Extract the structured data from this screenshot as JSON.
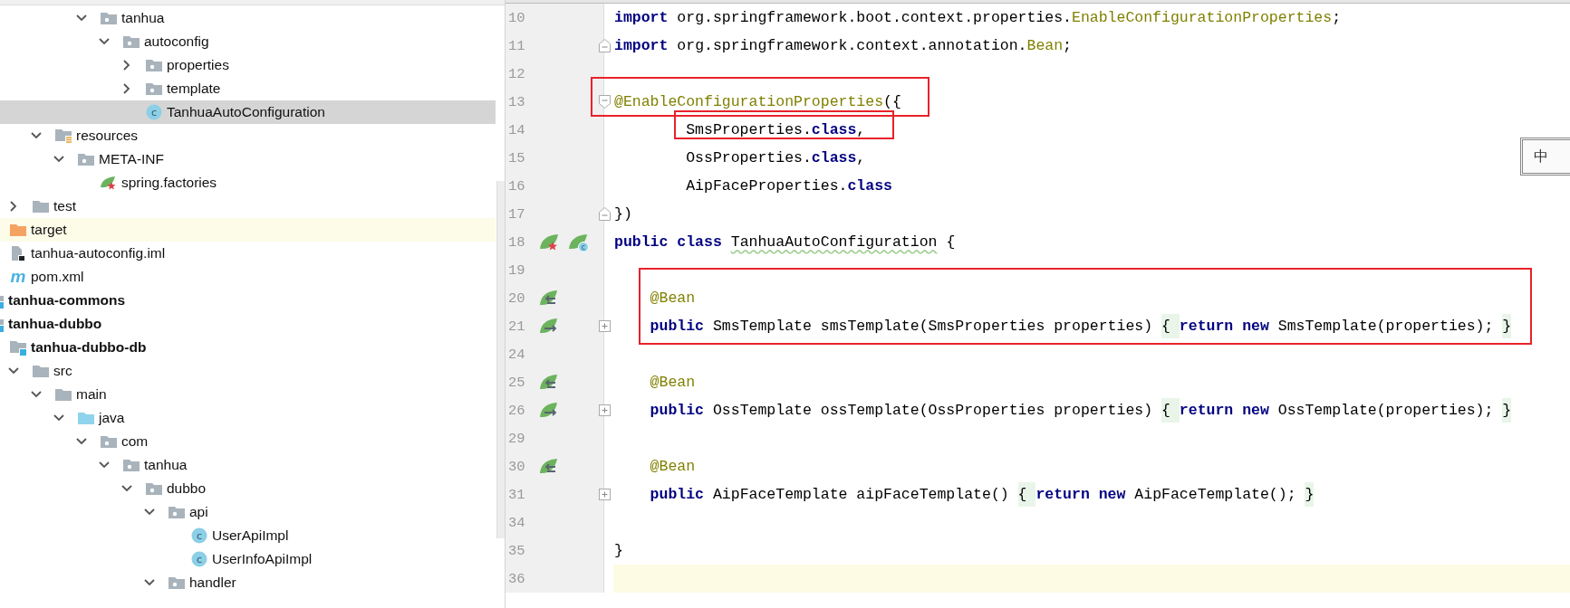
{
  "project_tree": {
    "items": [
      {
        "children": [
          {
            "children": [
              {
                "children": [
                  {
                    "children": [
                      {
                        "children": [
                          {
                            "label": "tanhua",
                            "kind": "package",
                            "expanded": true,
                            "selected": false,
                            "highlighted": false,
                            "children": [
                              {
                                "label": "autoconfig",
                                "kind": "package",
                                "expanded": true,
                                "selected": false,
                                "highlighted": false,
                                "children": [
                                  {
                                    "label": "properties",
                                    "kind": "package",
                                    "expanded": false,
                                    "selected": false,
                                    "highlighted": false
                                  },
                                  {
                                    "label": "template",
                                    "kind": "package",
                                    "expanded": false,
                                    "selected": false,
                                    "highlighted": false
                                  },
                                  {
                                    "label": "TanhuaAutoConfiguration",
                                    "kind": "class",
                                    "icon_text": "c",
                                    "selected": true,
                                    "highlighted": false
                                  }
                                ]
                              }
                            ]
                          }
                        ]
                      }
                    ]
                  },
                  {
                    "label": "resources",
                    "kind": "resources",
                    "expanded": true,
                    "selected": false,
                    "highlighted": false,
                    "children": [
                      {
                        "label": "META-INF",
                        "kind": "package",
                        "expanded": true,
                        "selected": false,
                        "highlighted": false,
                        "children": [
                          {
                            "label": "spring.factories",
                            "kind": "spring",
                            "selected": false,
                            "highlighted": false
                          }
                        ]
                      }
                    ]
                  }
                ]
              },
              {
                "label": "test",
                "kind": "folder",
                "expanded": false,
                "selected": false,
                "highlighted": false
              }
            ]
          },
          {
            "label": "target",
            "kind": "excluded",
            "selected": false,
            "highlighted": true
          },
          {
            "label": "tanhua-autoconfig.iml",
            "kind": "iml",
            "selected": false,
            "highlighted": false
          },
          {
            "label": "pom.xml",
            "kind": "maven",
            "icon_text": "m",
            "selected": false,
            "highlighted": false
          }
        ]
      },
      {
        "label": "tanhua-commons",
        "kind": "module",
        "selected": false,
        "highlighted": false
      },
      {
        "label": "tanhua-dubbo",
        "kind": "module",
        "selected": false,
        "highlighted": false,
        "children": [
          {
            "label": "tanhua-dubbo-db",
            "kind": "module",
            "selected": false,
            "highlighted": false,
            "children": [
              {
                "label": "src",
                "kind": "folder",
                "expanded": true,
                "selected": false,
                "highlighted": false,
                "children": [
                  {
                    "label": "main",
                    "kind": "folder",
                    "expanded": true,
                    "selected": false,
                    "highlighted": false,
                    "children": [
                      {
                        "label": "java",
                        "kind": "source",
                        "expanded": true,
                        "selected": false,
                        "highlighted": false,
                        "children": [
                          {
                            "label": "com",
                            "kind": "package",
                            "expanded": true,
                            "selected": false,
                            "highlighted": false,
                            "children": [
                              {
                                "label": "tanhua",
                                "kind": "package",
                                "expanded": true,
                                "selected": false,
                                "highlighted": false,
                                "children": [
                                  {
                                    "label": "dubbo",
                                    "kind": "package",
                                    "expanded": true,
                                    "selected": false,
                                    "highlighted": false,
                                    "children": [
                                      {
                                        "label": "api",
                                        "kind": "package",
                                        "expanded": true,
                                        "selected": false,
                                        "highlighted": false,
                                        "children": [
                                          {
                                            "label": "UserApiImpl",
                                            "kind": "class",
                                            "icon_text": "c",
                                            "selected": false,
                                            "highlighted": false
                                          },
                                          {
                                            "label": "UserInfoApiImpl",
                                            "kind": "class",
                                            "icon_text": "c",
                                            "selected": false,
                                            "highlighted": false
                                          }
                                        ]
                                      },
                                      {
                                        "label": "handler",
                                        "kind": "package",
                                        "expanded": true,
                                        "selected": false,
                                        "highlighted": false
                                      }
                                    ]
                                  }
                                ]
                              }
                            ]
                          }
                        ]
                      }
                    ]
                  }
                ]
              }
            ]
          }
        ]
      }
    ]
  },
  "editor": {
    "lines": [
      {
        "number": "10",
        "current": false,
        "tokens": [
          {
            "text": "import",
            "kind": "kw"
          },
          {
            "text": " org.springframework.boot.context.properties.",
            "kind": "plain"
          },
          {
            "text": "EnableConfigurationProperties",
            "kind": "ann"
          },
          {
            "text": ";",
            "kind": "plain"
          }
        ]
      },
      {
        "number": "11",
        "current": false,
        "fold_marker": {
          "kind": "end"
        },
        "tokens": [
          {
            "text": "import",
            "kind": "kw"
          },
          {
            "text": " org.springframework.context.annotation.",
            "kind": "plain"
          },
          {
            "text": "Bean",
            "kind": "ann"
          },
          {
            "text": ";",
            "kind": "plain"
          }
        ]
      },
      {
        "number": "12",
        "current": false
      },
      {
        "number": "13",
        "current": false,
        "fold_marker": {
          "kind": "start"
        },
        "tokens": [
          {
            "text": "@EnableConfigurationProperties",
            "kind": "ann"
          },
          {
            "text": "({",
            "kind": "plain"
          }
        ]
      },
      {
        "number": "14",
        "current": false,
        "tokens": [
          {
            "text": "        SmsProperties.",
            "kind": "plain"
          },
          {
            "text": "class",
            "kind": "kw"
          },
          {
            "text": ",",
            "kind": "plain"
          }
        ]
      },
      {
        "number": "15",
        "current": false,
        "tokens": [
          {
            "text": "        OssProperties.",
            "kind": "plain"
          },
          {
            "text": "class",
            "kind": "kw"
          },
          {
            "text": ",",
            "kind": "plain"
          }
        ]
      },
      {
        "number": "16",
        "current": false,
        "tokens": [
          {
            "text": "        AipFaceProperties.",
            "kind": "plain"
          },
          {
            "text": "class",
            "kind": "kw"
          }
        ]
      },
      {
        "number": "17",
        "current": false,
        "fold_marker": {
          "kind": "end"
        },
        "tokens": [
          {
            "text": "})",
            "kind": "plain"
          }
        ]
      },
      {
        "number": "18",
        "current": false,
        "gutter": [
          {
            "kind": "bean-star"
          },
          {
            "kind": "bean-class",
            "icon_text": "c"
          }
        ],
        "tokens": [
          {
            "text": "public class ",
            "kind": "kw"
          },
          {
            "text": "TanhuaAutoConfiguration",
            "kind": "typo"
          },
          {
            "text": " {",
            "kind": "plain"
          }
        ]
      },
      {
        "number": "19",
        "current": false
      },
      {
        "number": "20",
        "current": false,
        "gutter": [
          {
            "kind": "bean-in"
          }
        ],
        "tokens": [
          {
            "text": "    @Bean",
            "kind": "ann"
          }
        ]
      },
      {
        "number": "21",
        "current": false,
        "fold_marker": {
          "kind": "collapsed"
        },
        "gutter": [
          {
            "kind": "bean-out"
          }
        ],
        "tokens": [
          {
            "text": "    public",
            "kind": "kw"
          },
          {
            "text": " SmsTemplate smsTemplate(SmsProperties properties) ",
            "kind": "plain"
          },
          {
            "text": "{ ",
            "kind": "fold"
          },
          {
            "text": "return new",
            "kind": "kw"
          },
          {
            "text": " SmsTemplate(properties); ",
            "kind": "plain"
          },
          {
            "text": "}",
            "kind": "fold"
          }
        ]
      },
      {
        "number": "24",
        "current": false
      },
      {
        "number": "25",
        "current": false,
        "gutter": [
          {
            "kind": "bean-in"
          }
        ],
        "tokens": [
          {
            "text": "    @Bean",
            "kind": "ann"
          }
        ]
      },
      {
        "number": "26",
        "current": false,
        "fold_marker": {
          "kind": "collapsed"
        },
        "gutter": [
          {
            "kind": "bean-out"
          }
        ],
        "tokens": [
          {
            "text": "    public",
            "kind": "kw"
          },
          {
            "text": " OssTemplate ossTemplate(OssProperties properties) ",
            "kind": "plain"
          },
          {
            "text": "{ ",
            "kind": "fold"
          },
          {
            "text": "return new",
            "kind": "kw"
          },
          {
            "text": " OssTemplate(properties); ",
            "kind": "plain"
          },
          {
            "text": "}",
            "kind": "fold"
          }
        ]
      },
      {
        "number": "29",
        "current": false
      },
      {
        "number": "30",
        "current": false,
        "gutter": [
          {
            "kind": "bean-in"
          }
        ],
        "tokens": [
          {
            "text": "    @Bean",
            "kind": "ann"
          }
        ]
      },
      {
        "number": "31",
        "current": false,
        "fold_marker": {
          "kind": "collapsed"
        },
        "tokens": [
          {
            "text": "    public",
            "kind": "kw"
          },
          {
            "text": " AipFaceTemplate aipFaceTemplate() ",
            "kind": "plain"
          },
          {
            "text": "{ ",
            "kind": "fold"
          },
          {
            "text": "return new",
            "kind": "kw"
          },
          {
            "text": " AipFaceTemplate(); ",
            "kind": "plain"
          },
          {
            "text": "}",
            "kind": "fold"
          }
        ]
      },
      {
        "number": "34",
        "current": false
      },
      {
        "number": "35",
        "current": false,
        "tokens": [
          {
            "text": "}",
            "kind": "plain"
          }
        ]
      },
      {
        "number": "36",
        "current": true
      }
    ]
  },
  "ime_indicator": {
    "label": "中"
  }
}
